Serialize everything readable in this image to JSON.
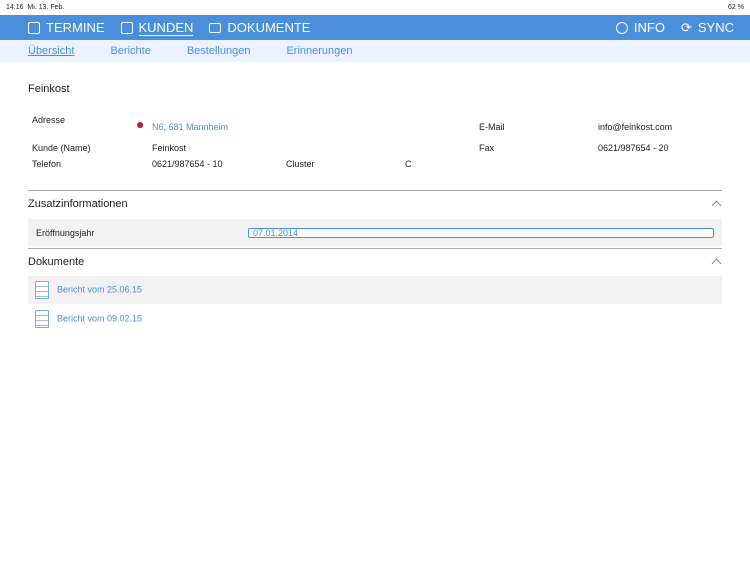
{
  "status": {
    "time": "14:16",
    "date": "Mi. 13. Feb.",
    "battery": "62 %"
  },
  "nav": {
    "termine": "TERMINE",
    "kunden": "KUNDEN",
    "dokumente": "DOKUMENTE",
    "info": "INFO",
    "sync": "SYNC"
  },
  "tabs": [
    "Übersicht",
    "Berichte",
    "Bestellungen",
    "Erinnerungen"
  ],
  "customer": {
    "title": "Feinkost",
    "adresse_label": "Adresse",
    "adresse": "N6, 681 Mannheim",
    "email_label": "E-Mail",
    "email": "info@feinkost.com",
    "kunde_label": "Kunde (Name)",
    "kunde": "Feinkost",
    "fax_label": "Fax",
    "fax": "0621/987654 - 20",
    "telefon_label": "Telefon",
    "telefon": "0621/987654 - 10",
    "cluster_label": "Cluster",
    "cluster": "C"
  },
  "zusatz": {
    "title": "Zusatzinformationen",
    "label": "Eröffnungsjahr",
    "value": "07.01.2014"
  },
  "dokumente": {
    "title": "Dokumente",
    "items": [
      "Bericht vom 25.06.15",
      "Bericht vom 09.02.15"
    ]
  }
}
